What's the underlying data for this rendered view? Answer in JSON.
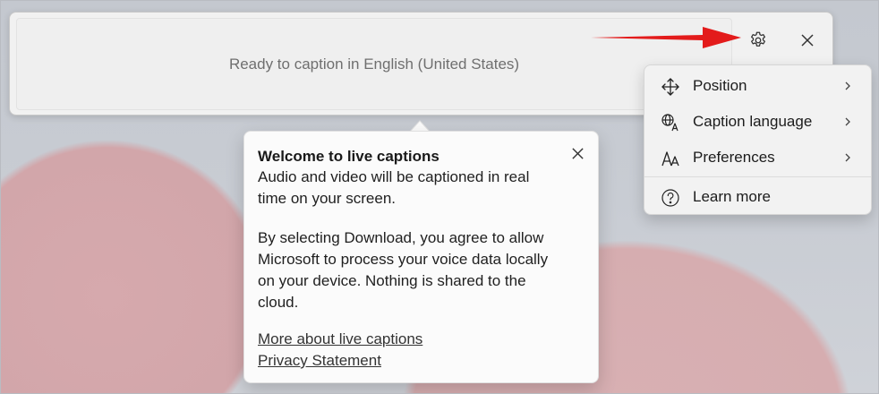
{
  "caption_window": {
    "status_text": "Ready to caption in English (United States)",
    "settings_icon": "gear-icon",
    "close_icon": "close-icon"
  },
  "annotation": {
    "arrow_color": "#e31b1b"
  },
  "settings_menu": {
    "items": [
      {
        "label": "Position",
        "icon": "move-arrows-icon",
        "has_submenu": true
      },
      {
        "label": "Caption language",
        "icon": "language-icon",
        "has_submenu": true
      },
      {
        "label": "Preferences",
        "icon": "font-size-icon",
        "has_submenu": true
      },
      {
        "label": "Learn more",
        "icon": "help-icon",
        "has_submenu": false
      }
    ]
  },
  "welcome_flyout": {
    "title": "Welcome to live captions",
    "body1": "Audio and video will be captioned in real time on your screen.",
    "body2": "By selecting Download, you agree to allow Microsoft to process your voice data locally on your device. Nothing is shared to the cloud.",
    "links": [
      "More about live captions",
      "Privacy Statement"
    ],
    "close_icon": "close-icon"
  }
}
